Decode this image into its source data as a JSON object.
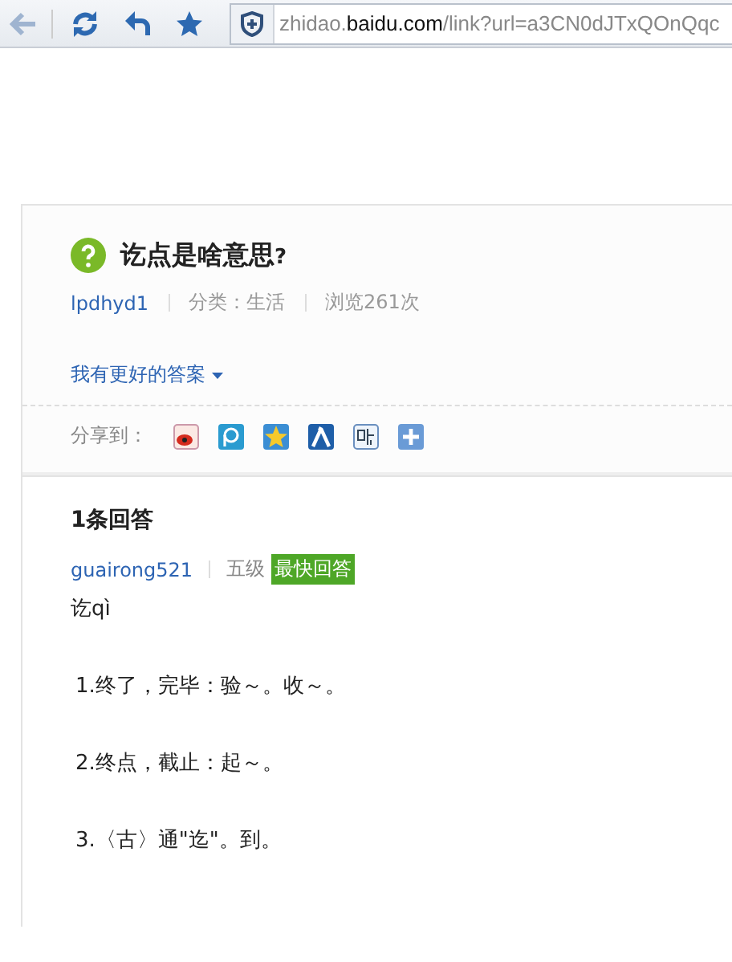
{
  "toolbar": {
    "url": "zhidao.**baidu.com**/link?url=a3CN0dJTxQOnQqc"
  },
  "question": {
    "title": "讫点是啥意思",
    "mark": "?",
    "author": "lpdhyd1",
    "category": "分类：生活",
    "views": "浏览261次",
    "better_answer": "我有更好的答案",
    "share_label": "分享到："
  },
  "answers": {
    "count": "1条回答",
    "author": "guairong521",
    "level": "五级",
    "badge": "最快回答",
    "pinyin": "讫qì",
    "lines": [
      "1.终了，完毕：验～。收～。",
      "2.终点，截止：起～。",
      "3.〈古〉通\"迄\"。到。"
    ]
  }
}
